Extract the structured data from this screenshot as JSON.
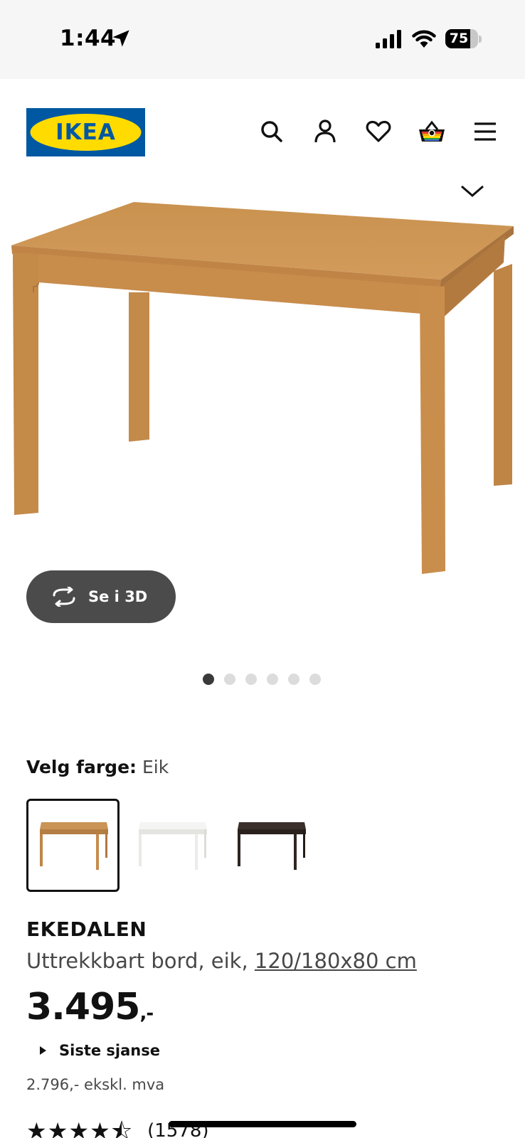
{
  "status_bar": {
    "time": "1:44",
    "battery_level": "75",
    "battery_fraction": 0.75
  },
  "header": {
    "logo_text": "IKEA",
    "brand_colors": {
      "blue": "#0058a3",
      "yellow": "#ffdb00"
    },
    "icons": [
      "search-icon",
      "account-icon",
      "heart-icon",
      "cart-icon",
      "menu-icon"
    ]
  },
  "gallery": {
    "view_3d_label": "Se i 3D",
    "image_count": 6,
    "active_index": 0
  },
  "color_selector": {
    "label": "Velg farge:",
    "selected_value": "Eik",
    "options": [
      "oak",
      "white",
      "black-brown"
    ]
  },
  "product": {
    "name": "EKEDALEN",
    "description": "Uttrekkbart bord, eik, ",
    "measurement": "120/180x80 cm",
    "price": "3.495",
    "price_suffix": ",-",
    "last_chance": "Siste sjanse",
    "price_excl_vat": "2.796,- ekskl. mva",
    "rating_stars": "★★★★⯪",
    "rating_count": "(1578)"
  }
}
